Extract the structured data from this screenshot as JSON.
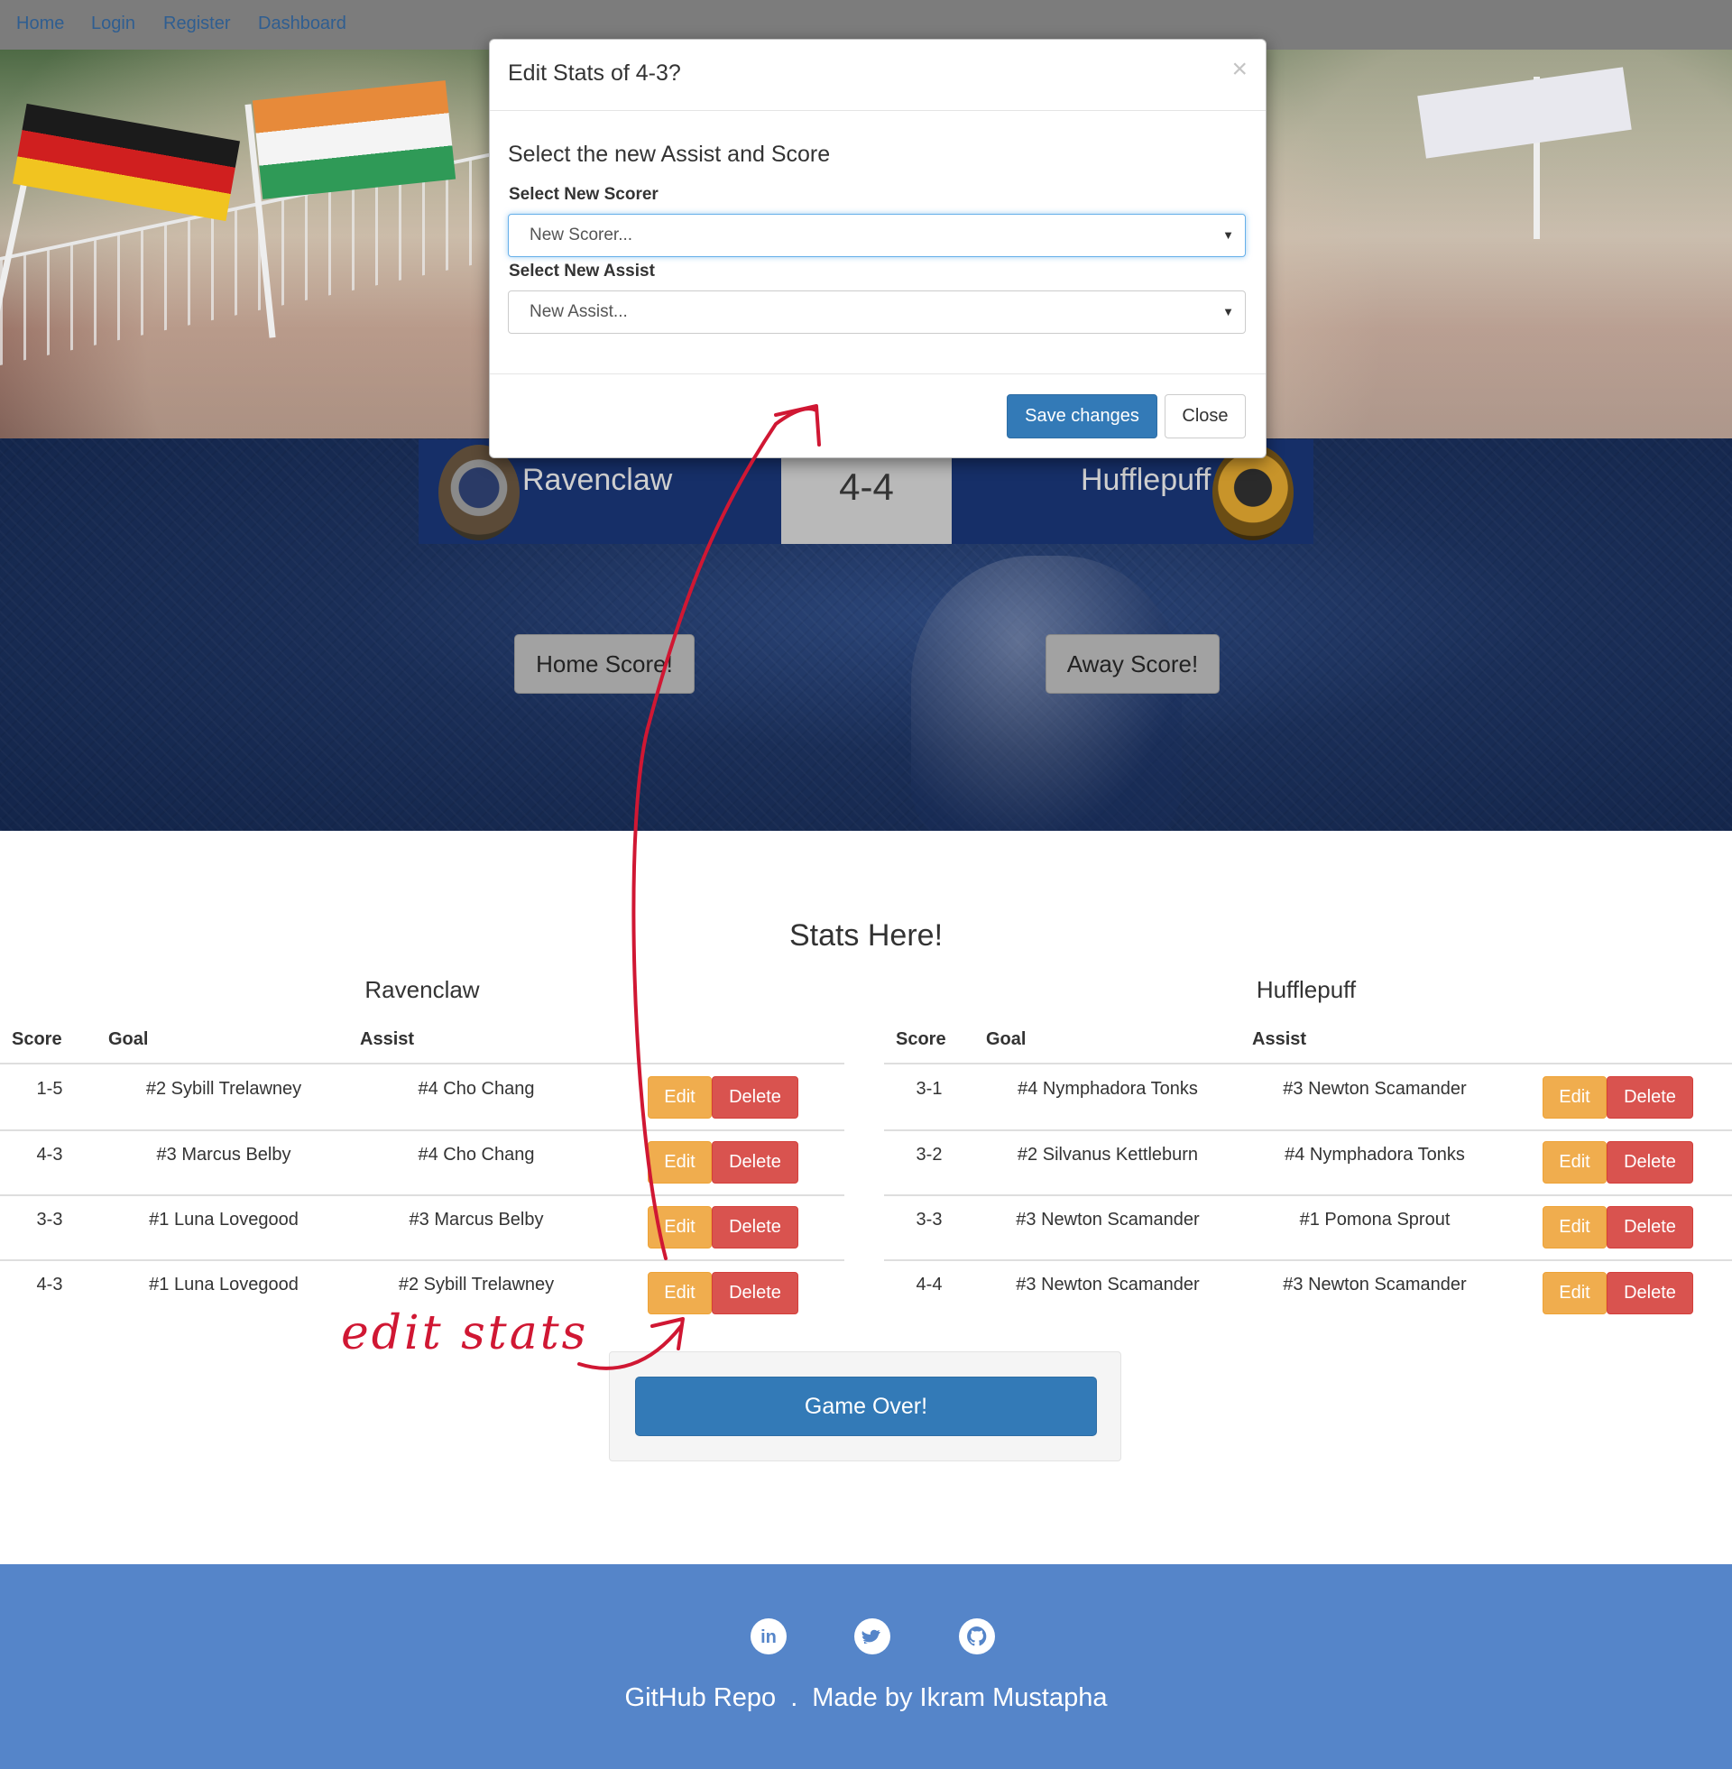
{
  "navbar": {
    "links": [
      "Home",
      "Login",
      "Register",
      "Dashboard"
    ]
  },
  "scoreboard": {
    "home_team": "Ravenclaw",
    "away_team": "Hufflepuff",
    "score": "4-4",
    "home_score_button": "Home Score!",
    "away_score_button": "Away Score!"
  },
  "stats": {
    "title": "Stats Here!",
    "columns": {
      "score": "Score",
      "goal": "Goal",
      "assist": "Assist"
    },
    "edit_label": "Edit",
    "delete_label": "Delete",
    "home": {
      "team": "Ravenclaw",
      "rows": [
        {
          "score": "1-5",
          "goal": "#2 Sybill Trelawney",
          "assist": "#4 Cho Chang"
        },
        {
          "score": "4-3",
          "goal": "#3 Marcus Belby",
          "assist": "#4 Cho Chang"
        },
        {
          "score": "3-3",
          "goal": "#1 Luna Lovegood",
          "assist": "#3 Marcus Belby"
        },
        {
          "score": "4-3",
          "goal": "#1 Luna Lovegood",
          "assist": "#2 Sybill Trelawney"
        }
      ]
    },
    "away": {
      "team": "Hufflepuff",
      "rows": [
        {
          "score": "3-1",
          "goal": "#4 Nymphadora Tonks",
          "assist": "#3 Newton Scamander"
        },
        {
          "score": "3-2",
          "goal": "#2 Silvanus Kettleburn",
          "assist": "#4 Nymphadora Tonks"
        },
        {
          "score": "3-3",
          "goal": "#3 Newton Scamander",
          "assist": "#1 Pomona Sprout"
        },
        {
          "score": "4-4",
          "goal": "#3 Newton Scamander",
          "assist": "#3 Newton Scamander"
        }
      ]
    },
    "game_over_button": "Game Over!"
  },
  "footer": {
    "social_icons": [
      "linkedin-icon",
      "twitter-icon",
      "github-icon"
    ],
    "repo_link": "GitHub Repo",
    "separator": ".",
    "credit": "Made by Ikram Mustapha"
  },
  "modal": {
    "title": "Edit Stats of 4-3?",
    "close_glyph": "×",
    "subtitle": "Select the new Assist and Score",
    "scorer_label": "Select New Scorer",
    "scorer_placeholder": "New Scorer...",
    "assist_label": "Select New Assist",
    "assist_placeholder": "New Assist...",
    "save_button": "Save changes",
    "close_button": "Close"
  },
  "annotation": {
    "text": "edit stats",
    "color": "#d01733"
  },
  "colors": {
    "navbar": "#7c7c7c",
    "primary": "#337ab7",
    "warning": "#f0ad4e",
    "danger": "#d9534f",
    "footer": "#5585c9",
    "scoreboard": "#162f68"
  }
}
